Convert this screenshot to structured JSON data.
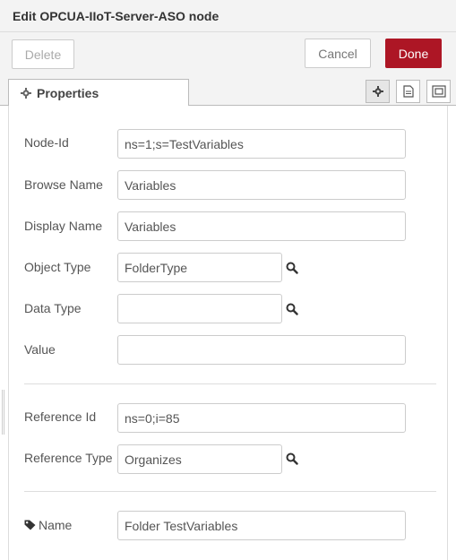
{
  "tray": {
    "title": "Edit OPCUA-IIoT-Server-ASO node"
  },
  "toolbar": {
    "delete_label": "Delete",
    "cancel_label": "Cancel",
    "done_label": "Done"
  },
  "tabs": {
    "properties_label": "Properties",
    "icons": [
      "gear-icon",
      "document-icon",
      "frame-icon"
    ]
  },
  "fields": {
    "node_id": {
      "label": "Node-Id",
      "value": "ns=1;s=TestVariables"
    },
    "browse_name": {
      "label": "Browse Name",
      "value": "Variables"
    },
    "display_name": {
      "label": "Display Name",
      "value": "Variables"
    },
    "object_type": {
      "label": "Object Type",
      "value": "FolderType"
    },
    "data_type": {
      "label": "Data Type",
      "value": ""
    },
    "value": {
      "label": "Value",
      "value": ""
    },
    "reference_id": {
      "label": "Reference Id",
      "value": "ns=0;i=85"
    },
    "reference_type": {
      "label": "Reference Type",
      "value": "Organizes"
    },
    "name": {
      "label": "Name",
      "value": "Folder TestVariables"
    }
  },
  "colors": {
    "done_button": "#ad1625",
    "header_bg": "#f3f3f3"
  }
}
